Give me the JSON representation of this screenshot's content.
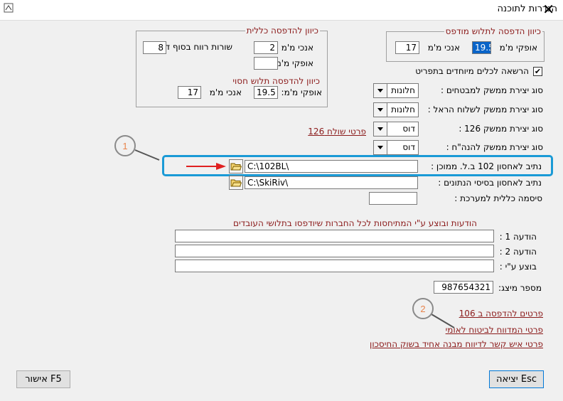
{
  "window": {
    "title": "הגדרות לתוכנה"
  },
  "group_general": {
    "title": "כיוון להדפסה כללית",
    "vertical_label": "אנכי מ'מ",
    "vertical_value": "2",
    "rows_label": "שורות רווח בסוף דף :",
    "rows_value": "8",
    "horizontal_label": "אופקי מ'מ :",
    "horizontal_value": "",
    "sub_title": "כיוון להדפסה תלוש חסוי",
    "sub_horizontal_label": "אופקי מ'מ:",
    "sub_horizontal_value": "19.5",
    "sub_vertical_label": "אנכי מ'מ",
    "sub_vertical_value": "17"
  },
  "group_printed": {
    "title": "כיוון הדפסה לתלוש מודפס",
    "horizontal_label": "אופקי מ'מ",
    "horizontal_value": "19.5",
    "vertical_label": "אנכי מ'מ",
    "vertical_value": "17"
  },
  "special_tools": {
    "label": "הרשאה לכלים מיוחדים בתפריט",
    "checked": true
  },
  "interfaces": {
    "insurance_label": "סוג יצירת ממשק למבטחים :",
    "insurance_value": "חלונות",
    "israel_label": "סוג יצירת ממשק לשלוח הראל :",
    "israel_value": "חלונות",
    "i126_label": "סוג יצירת ממשק 126 :",
    "i126_value": "דוס",
    "hanhach_label": "סוג יצירת ממשק להנה\"ח :",
    "hanhach_value": "דוס",
    "sender_link": "פרטי שולח 126"
  },
  "paths": {
    "archive_label": "נתיב לאחסון 102 ב.ל. ממוכן :",
    "archive_value": "C:\\102BL\\",
    "db_label": "נתיב לאחסון בסיסי הנתונים :",
    "db_value": "C:\\SkiRiv\\",
    "password_label": "סיסמה כללית למערכת :",
    "password_value": ""
  },
  "messages": {
    "header": "הודעות ובוצע ע\"י המתיחסות לכל החברות שיודפסו בתלושי העובדים",
    "msg1_label": "הודעה 1 :",
    "msg1_value": "",
    "msg2_label": "הודעה 2 :",
    "msg2_value": "",
    "done_label": "בוצע ע\"י :",
    "done_value": ""
  },
  "rep": {
    "label": "מספר מיצג:",
    "value": "987654321"
  },
  "links": {
    "print106": "פרטים להדפסה ב 106",
    "nii": "פרטי המדווח לביטוח לאומי",
    "contact": "פרטי איש קשר לדיווח מבנה אחיד בשוק החיסכון"
  },
  "buttons": {
    "exit": "יציאה Esc",
    "ok": "אישור F5"
  },
  "callouts": {
    "c1": "1",
    "c2": "2"
  },
  "colors": {
    "accent": "#1a9ad6",
    "darkred": "#8b1a1a",
    "arrow": "#e02020",
    "callout": "#e8834a"
  }
}
